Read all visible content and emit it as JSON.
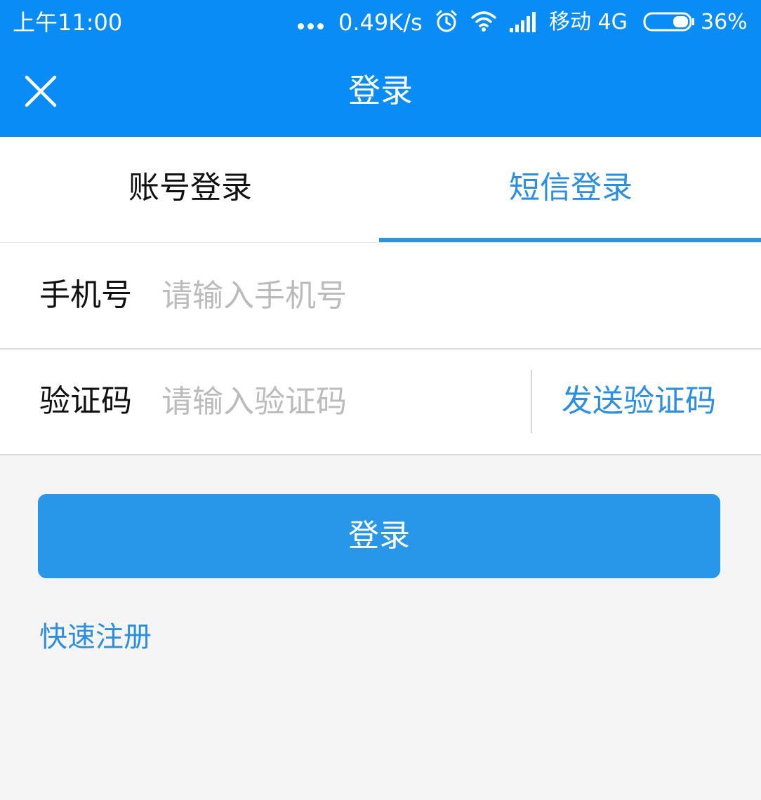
{
  "status_bar": {
    "time": "上午11:00",
    "network_speed": "0.49K/s",
    "carrier": "移动 4G",
    "battery_percent": "36%",
    "battery_level": 0.36,
    "icons": [
      "more-dots-icon",
      "alarm-icon",
      "wifi-icon",
      "signal-icon",
      "battery-icon"
    ]
  },
  "header": {
    "close_icon": "close-icon",
    "title": "登录"
  },
  "tabs": [
    {
      "label": "账号登录",
      "active": false
    },
    {
      "label": "短信登录",
      "active": true
    }
  ],
  "form": {
    "phone": {
      "label": "手机号",
      "placeholder": "请输入手机号",
      "value": ""
    },
    "code": {
      "label": "验证码",
      "placeholder": "请输入验证码",
      "value": "",
      "send_label": "发送验证码"
    }
  },
  "login_button": "登录",
  "register_link": "快速注册",
  "colors": {
    "primary": "#0a8cf7",
    "accent": "#2a8fe4",
    "button": "#2897ea",
    "background": "#f5f5f5"
  }
}
